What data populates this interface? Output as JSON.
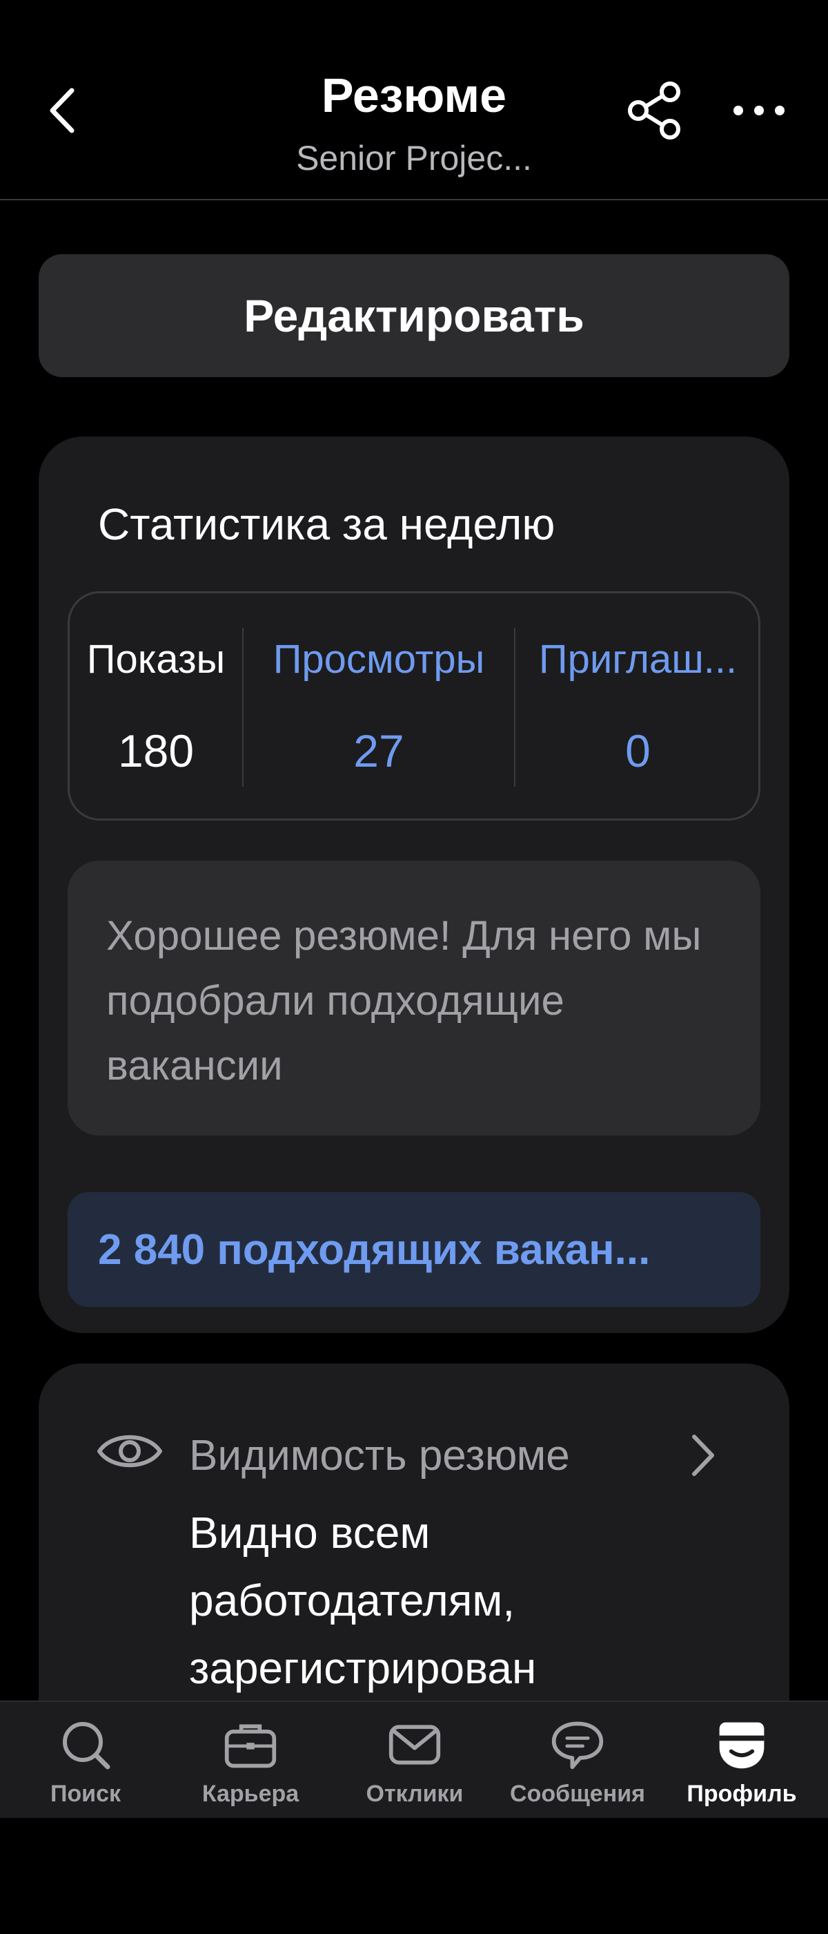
{
  "header": {
    "title": "Резюме",
    "subtitle": "Senior Projec...",
    "back_icon": "chevron-left-icon",
    "share_icon": "share-icon",
    "more_icon": "more-horizontal-icon"
  },
  "edit_button": {
    "label": "Редактировать"
  },
  "stats": {
    "title": "Статистика за неделю",
    "columns": [
      {
        "label": "Показы",
        "value": "180"
      },
      {
        "label": "Просмотры",
        "value": "27"
      },
      {
        "label": "Приглаш...",
        "value": "0"
      }
    ],
    "note": "Хорошее резюме! Для него мы подобрали подходящие вакансии",
    "vacancies_button": "2 840 подходящих вакан..."
  },
  "visibility": {
    "icon": "eye-icon",
    "title": "Видимость резюме",
    "value": "Видно всем работодателям, зарегистрирован"
  },
  "tabbar": {
    "items": [
      {
        "label": "Поиск",
        "icon": "search-icon"
      },
      {
        "label": "Карьера",
        "icon": "briefcase-icon"
      },
      {
        "label": "Отклики",
        "icon": "mail-icon"
      },
      {
        "label": "Сообщения",
        "icon": "chat-icon"
      },
      {
        "label": "Профиль",
        "icon": "profile-icon",
        "active": true
      }
    ]
  },
  "colors": {
    "background": "#000000",
    "card": "#1c1c1e",
    "accent_blue": "#6f9bf0",
    "muted_text": "#a1a1a6"
  }
}
